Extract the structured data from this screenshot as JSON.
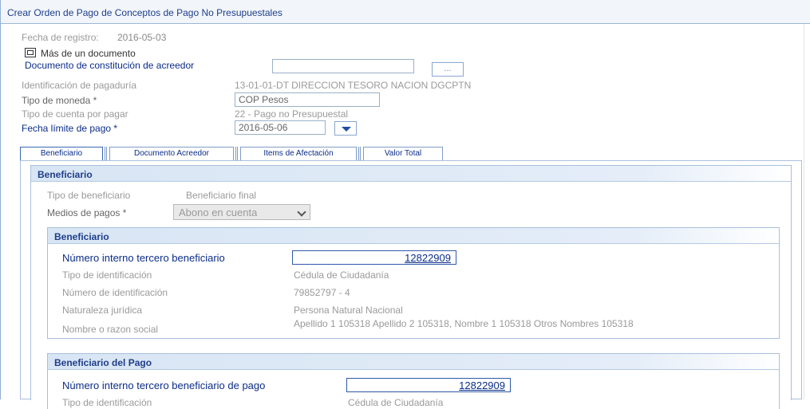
{
  "window": {
    "title": "Crear Orden de Pago de Conceptos de Pago No Presupuestales"
  },
  "header": {
    "fecha_registro_label": "Fecha de registro:",
    "fecha_registro_value": "2016-05-03",
    "mas_documento_label": "Más de un documento",
    "doc_constitucion_label": "Documento de constitución de acreedor",
    "doc_constitucion_value": "",
    "ellipsis_label": "...",
    "pagaduria_label": "Identificación de pagaduría",
    "pagaduria_value": "13-01-01-DT DIRECCION TESORO NACION DGCPTN",
    "moneda_label": "Tipo de moneda *",
    "moneda_value": "COP Pesos",
    "tipo_cuenta_label": "Tipo de cuenta por pagar",
    "tipo_cuenta_value": "22 - Pago no Presupuestal",
    "fecha_limite_label": "Fecha límite de pago *",
    "fecha_limite_value": "2016-05-06"
  },
  "tabs": [
    {
      "label": "Beneficiario"
    },
    {
      "label": "Documento Acreedor"
    },
    {
      "label": "Items de Afectación"
    },
    {
      "label": "Valor Total"
    }
  ],
  "beneficiario_panel": {
    "title": "Beneficiario",
    "tipo_label": "Tipo de beneficiario",
    "tipo_value": "Beneficiario final",
    "medios_label": "Medios de pagos *",
    "medios_value": "Abono en cuenta"
  },
  "beneficiario_section": {
    "title": "Beneficiario",
    "numero_label": "Número interno tercero beneficiario",
    "numero_value": "12822909",
    "tipo_id_label": "Tipo de identificación",
    "tipo_id_value": "Cédula de Ciudadanía",
    "num_id_label": "Número de identificación",
    "num_id_value": "79852797 - 4",
    "naturaleza_label": "Naturaleza jurídica",
    "naturaleza_value": "Persona Natural Nacional",
    "nombre_label": "Nombre o razon social",
    "nombre_value": "Apellido 1 105318 Apellido 2 105318, Nombre 1 105318 Otros Nombres 105318"
  },
  "beneficiario_pago_section": {
    "title": "Beneficiario del Pago",
    "numero_label": "Número interno tercero beneficiario de pago",
    "numero_value": "12822909",
    "tipo_id_label": "Tipo de identificación",
    "tipo_id_value": "Cédula de Ciudadanía"
  },
  "colors": {
    "accent_blue": "#0b2d8a",
    "grey_text": "#9a9a9a",
    "header_bg": "#d8e5f4"
  },
  "icons": {
    "checkbox": "checkbox-icon",
    "dropdown": "chevron-down-icon"
  }
}
